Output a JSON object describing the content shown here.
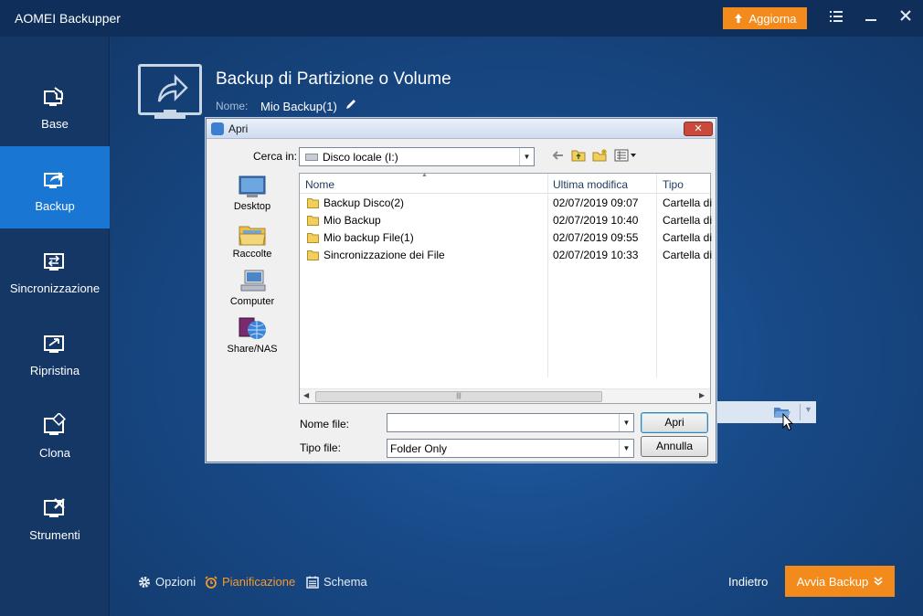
{
  "app": {
    "title": "AOMEI Backupper",
    "upgrade_label": "Aggiorna"
  },
  "sidebar": {
    "items": [
      {
        "label": "Base",
        "icon": "home-monitor-icon",
        "active": false
      },
      {
        "label": "Backup",
        "icon": "backup-monitor-icon",
        "active": true
      },
      {
        "label": "Sincronizzazione",
        "icon": "sync-monitor-icon",
        "active": false
      },
      {
        "label": "Ripristina",
        "icon": "restore-monitor-icon",
        "active": false
      },
      {
        "label": "Clona",
        "icon": "clone-monitor-icon",
        "active": false
      },
      {
        "label": "Strumenti",
        "icon": "tools-monitor-icon",
        "active": false
      }
    ]
  },
  "main": {
    "title": "Backup di Partizione o Volume",
    "name_label": "Nome:",
    "name_value": "Mio Backup(1)",
    "bottom": {
      "options": "Opzioni",
      "schedule": "Pianificazione",
      "scheme": "Schema",
      "back": "Indietro",
      "start": "Avvia Backup"
    }
  },
  "dialog": {
    "title": "Apri",
    "look_in_label": "Cerca in:",
    "look_in_value": "Disco locale (I:)",
    "places": [
      "Desktop",
      "Raccolte",
      "Computer",
      "Share/NAS"
    ],
    "columns": [
      "Nome",
      "Ultima modifica",
      "Tipo"
    ],
    "rows": [
      {
        "name": "Backup Disco(2)",
        "modified": "02/07/2019 09:07",
        "type": "Cartella di"
      },
      {
        "name": "Mio Backup",
        "modified": "02/07/2019 10:40",
        "type": "Cartella di"
      },
      {
        "name": "Mio backup File(1)",
        "modified": "02/07/2019 09:55",
        "type": "Cartella di"
      },
      {
        "name": "Sincronizzazione dei File",
        "modified": "02/07/2019 10:33",
        "type": "Cartella di"
      }
    ],
    "filename_label": "Nome file:",
    "filename_value": "",
    "filetype_label": "Tipo file:",
    "filetype_value": "Folder Only",
    "open_button": "Apri",
    "cancel_button": "Annulla"
  },
  "colors": {
    "accent": "#f28a1c",
    "sidebar_active": "#1976d2",
    "sidebar_bg": "#143766"
  }
}
